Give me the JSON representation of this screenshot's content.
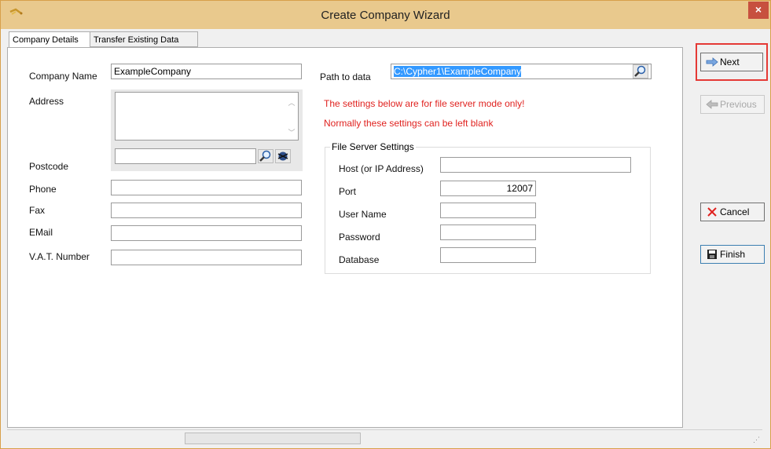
{
  "window": {
    "title": "Create Company Wizard",
    "close_glyph": "×"
  },
  "tabs": [
    {
      "label": "Company Details",
      "active": true
    },
    {
      "label": "Transfer Existing Data",
      "active": false
    }
  ],
  "form": {
    "company_name": {
      "label": "Company Name",
      "value": "ExampleCompany"
    },
    "address": {
      "label": "Address",
      "value": ""
    },
    "postcode": {
      "label": "Postcode",
      "value": ""
    },
    "phone": {
      "label": "Phone",
      "value": ""
    },
    "fax": {
      "label": "Fax",
      "value": ""
    },
    "email": {
      "label": "EMail",
      "value": ""
    },
    "vat": {
      "label": "V.A.T. Number",
      "value": ""
    }
  },
  "path": {
    "label": "Path to data",
    "value": "C:\\Cypher1\\ExampleCompany"
  },
  "notes": {
    "line1": "The settings below are for file server mode only!",
    "line2": "Normally these settings can be left  blank",
    "color": "#e0221f"
  },
  "file_server": {
    "title": "File Server Settings",
    "host": {
      "label": "Host (or IP Address)",
      "value": ""
    },
    "port": {
      "label": "Port",
      "value": "12007"
    },
    "user": {
      "label": "User Name",
      "value": ""
    },
    "password": {
      "label": "Password",
      "value": ""
    },
    "database": {
      "label": "Database",
      "value": ""
    }
  },
  "buttons": {
    "next": "Next",
    "previous": "Previous",
    "cancel": "Cancel",
    "finish": "Finish"
  },
  "icons": [
    "wizard-wand-icon",
    "search-icon",
    "postcode-lookup-icon",
    "arrow-right-icon",
    "arrow-left-icon",
    "cancel-x-icon",
    "save-disk-icon"
  ],
  "colors": {
    "title_bar": "#e9c98d",
    "highlight": "#e53935",
    "close": "#c7503f",
    "selection": "#3399ff"
  }
}
